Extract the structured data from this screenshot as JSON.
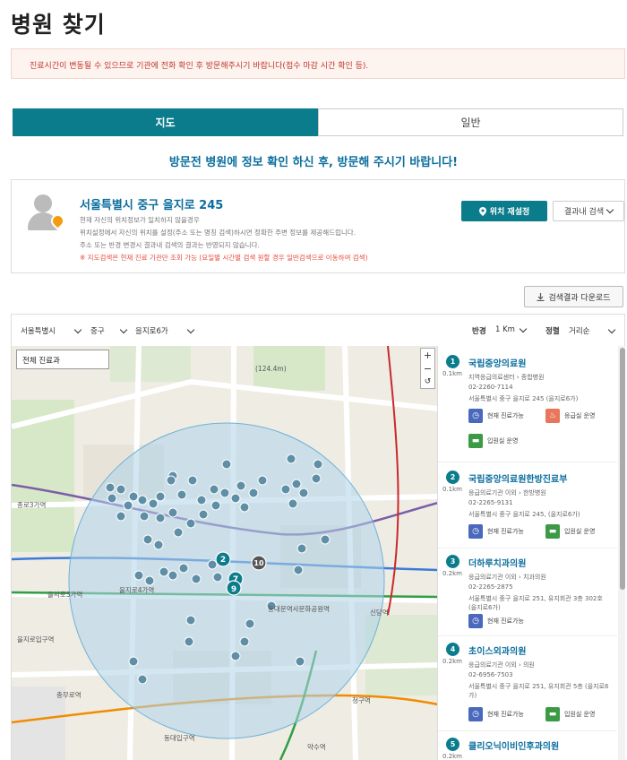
{
  "page": {
    "title": "병원 찾기",
    "notice": "진료시간이 변동될 수 있으므로 기관에 전화 확인 후 방문해주시기 바랍니다(접수 마감 시간 확인 등).",
    "visit_message": "방문전 병원에 정보 확인 하신 후, 방문해 주시기 바랍니다!"
  },
  "tabs": [
    {
      "label": "지도",
      "active": true
    },
    {
      "label": "일반",
      "active": false
    }
  ],
  "location": {
    "address": "서울특별시 중구 을지로 245",
    "line1": "현재 자신의 위치정보가 일치하지 않을경우",
    "line2": "위치설정에서 자신의 위치를 설정(주소 또는 명칭 검색)하시면 정확한 주변 정보를 제공해드립니다.",
    "line3": "주소 또는 반경 변경시 결과내 검색의 결과는 반영되지 않습니다.",
    "warning": "※ 지도검색은 현재 진료 기관만 조회 가능 (요일별 시간별 검색 원할 경우 일반검색으로 이동하여 검색)",
    "relocate_label": "위치 재설정",
    "result_search_label": "결과내 검색"
  },
  "download_label": "검색결과 다운로드",
  "filters": {
    "city": "서울특별시",
    "district": "중구",
    "street": "을지로6가",
    "radius_label": "반경",
    "radius_value": "1 Km",
    "sort_label": "정렬",
    "sort_value": "거리순"
  },
  "map": {
    "department_select": "전체 진료과",
    "zoom_in": "+",
    "zoom_out": "−",
    "zoom_reset": "↺",
    "markers_labelled": [
      "2",
      "7",
      "9",
      "10"
    ],
    "scale_label": "(124.4m)",
    "place_labels": [
      "동대문역사문화공원역",
      "을지로4가역",
      "충무로역",
      "종로3가역",
      "을지로3가역",
      "신당역",
      "청구역",
      "동대입구역",
      "약수역",
      "을지로입구역"
    ],
    "colors": {
      "radius_fill": "#aed4ea",
      "marker": "#0b7c8c",
      "tab_active": "#0b7c8c"
    }
  },
  "results": [
    {
      "num": "1",
      "distance": "0.1km",
      "name": "국립중앙의료원",
      "type": "지역응급의료센터 › 종합병원",
      "phone": "02-2260-7114",
      "address": "서울특별시 중구 을지로 245 (을지로6가)",
      "badges": [
        "현재 진료가능",
        "응급실 운영",
        "입원실 운영"
      ]
    },
    {
      "num": "2",
      "distance": "0.1km",
      "name": "국립중앙의료원한방진료부",
      "type": "응급의료기관 이외 › 한방병원",
      "phone": "02-2265-9131",
      "address": "서울특별시 중구 을지로 245, (을지로6가)",
      "badges": [
        "현재 진료가능",
        "입원실 운영"
      ]
    },
    {
      "num": "3",
      "distance": "0.2km",
      "name": "더하루치과의원",
      "type": "응급의료기관 이외 › 치과의원",
      "phone": "02-2265-2875",
      "address": "서울특별시 중구 을지로 251, 유지회관 3층 302호 (을지로6가)",
      "badges": [
        "현재 진료가능"
      ]
    },
    {
      "num": "4",
      "distance": "0.2km",
      "name": "초이스외과의원",
      "type": "응급의료기관 이외 › 의원",
      "phone": "02-6956-7503",
      "address": "서울특별시 중구 을지로 251, 유지회관 5층 (을지로6가)",
      "badges": [
        "현재 진료가능",
        "입원실 운영"
      ]
    },
    {
      "num": "5",
      "distance": "0.2km",
      "name": "클리오닉이비인후과의원",
      "type": "",
      "phone": "",
      "address": "",
      "badges": []
    }
  ]
}
